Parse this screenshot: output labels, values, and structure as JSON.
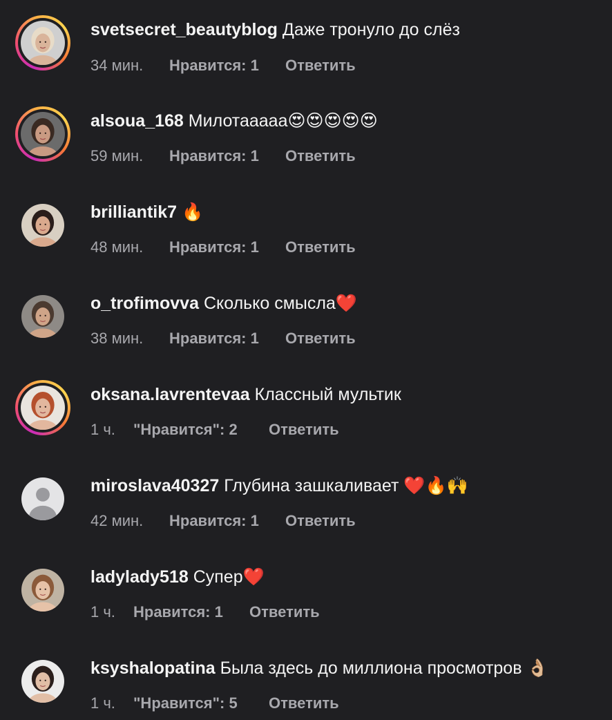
{
  "comments": [
    {
      "username": "svetsecret_beautyblog",
      "text": "Даже тронуло до слёз",
      "time": "34 мин.",
      "likes": "Нравится: 1",
      "reply": "Ответить",
      "story": true,
      "skin": "#d9b49a",
      "hair": "#e8dcc8",
      "bg": "#cfcfcf"
    },
    {
      "username": "alsoua_168",
      "text": "Милотааааа😍😍😍😍😍",
      "time": "59 мин.",
      "likes": "Нравится: 1",
      "reply": "Ответить",
      "story": true,
      "skin": "#c99a82",
      "hair": "#3a2a22",
      "bg": "#6b6b6b"
    },
    {
      "username": "brilliantik7",
      "text": "🔥",
      "time": "48 мин.",
      "likes": "Нравится: 1",
      "reply": "Ответить",
      "story": false,
      "skin": "#d9a98d",
      "hair": "#2a1d1a",
      "bg": "#d8cfc2"
    },
    {
      "username": "o_trofimovva",
      "text": "Сколько смысла❤️",
      "time": "38 мин.",
      "likes": "Нравится: 1",
      "reply": "Ответить",
      "story": false,
      "skin": "#cfa488",
      "hair": "#4b3a30",
      "bg": "#8e8a86"
    },
    {
      "username": "oksana.lavrentevaa",
      "text": "Классный мультик",
      "time": "1 ч.",
      "likes": "\"Нравится\": 2",
      "reply": "Ответить",
      "story": true,
      "skin": "#e2b79e",
      "hair": "#b5502d",
      "bg": "#e9e4de"
    },
    {
      "username": "miroslava40327",
      "text": "Глубина зашкаливает ❤️🔥🙌",
      "time": "42 мин.",
      "likes": "Нравится: 1",
      "reply": "Ответить",
      "story": false,
      "default": true
    },
    {
      "username": "ladylady518",
      "text": "Супер❤️",
      "time": "1 ч.",
      "likes": "Нравится: 1",
      "reply": "Ответить",
      "story": false,
      "skin": "#e6c2a8",
      "hair": "#8b5a3a",
      "bg": "#bfb3a3"
    },
    {
      "username": "ksyshalopatina",
      "text": "Была здесь до миллиона просмотров 👌🏼",
      "time": "1 ч.",
      "likes": "\"Нравится\": 5",
      "reply": "Ответить",
      "story": false,
      "skin": "#e1bea6",
      "hair": "#2b1f1c",
      "bg": "#ececec"
    }
  ]
}
